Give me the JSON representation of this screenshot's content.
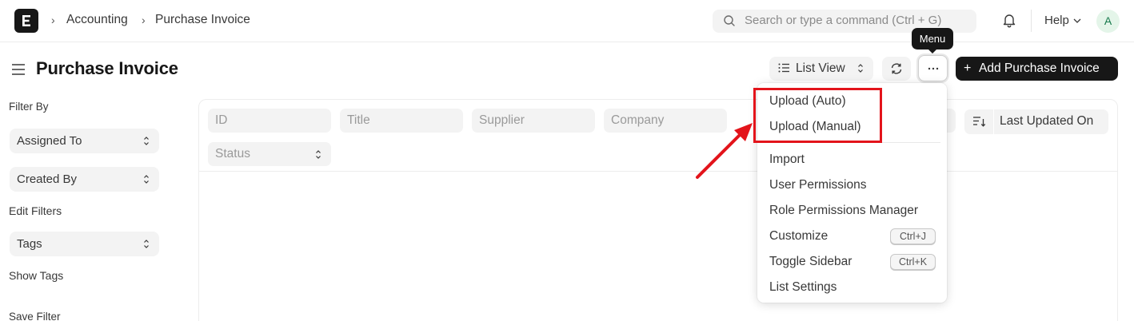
{
  "navbar": {
    "logo_letter": "E",
    "breadcrumbs": [
      "Accounting",
      "Purchase Invoice"
    ],
    "search_placeholder": "Search or type a command (Ctrl + G)",
    "help_label": "Help",
    "avatar_initial": "A"
  },
  "header": {
    "title": "Purchase Invoice",
    "view_label": "List View",
    "menu_tooltip": "Menu",
    "primary_button": "Add Purchase Invoice",
    "primary_button_icon": "+"
  },
  "sidebar": {
    "filter_by_label": "Filter By",
    "filters": [
      "Assigned To",
      "Created By"
    ],
    "edit_filters": "Edit Filters",
    "tags_select": "Tags",
    "show_tags": "Show Tags",
    "save_filter": "Save Filter"
  },
  "list_filters": {
    "id": "ID",
    "title": "Title",
    "supplier": "Supplier",
    "company": "Company",
    "status": "Status",
    "sort_label": "Last Updated On"
  },
  "menu": {
    "items": [
      "Upload (Auto)",
      "Upload (Manual)",
      "Import",
      "User Permissions",
      "Role Permissions Manager",
      "Customize",
      "Toggle Sidebar",
      "List Settings"
    ],
    "shortcuts": {
      "customize": "Ctrl+J",
      "toggle_sidebar": "Ctrl+K"
    }
  },
  "annotation": {
    "highlight_color": "#e3141b"
  },
  "colors": {
    "primary": "#171717",
    "avatar_bg": "#e4f5e9",
    "avatar_fg": "#16794c"
  }
}
